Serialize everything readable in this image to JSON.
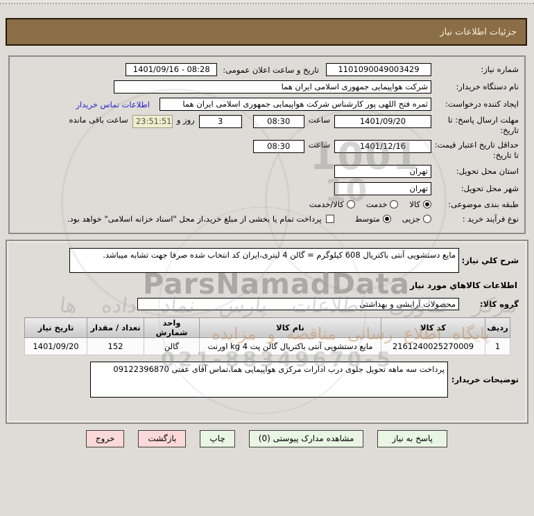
{
  "title_bar": {
    "title": "جزئیات اطلاعات نیاز"
  },
  "section1": {
    "need_number_label": "شماره نیاز:",
    "need_number_value": "1101090049003429",
    "announce_label": "تاریخ و ساعت اعلان عمومی:",
    "announce_value": "1401/09/16 - 08:28",
    "buyer_org_label": "نام دستگاه خریدار:",
    "buyer_org_value": "شرکت هواپیمایی جمهوری اسلامی ایران هما",
    "creator_label": "ایجاد کننده درخواست:",
    "creator_value": "ثمره فتح اللهی پور کارشناس شرکت هواپیمایی جمهوری اسلامی ایران هما",
    "contact_link": "اطلاعات تماس خریدار",
    "deadline_label": "مهلت ارسال پاسخ: تا تاریخ:",
    "deadline_date": "1401/09/20",
    "hour_label": "ساعت",
    "deadline_time": "08:30",
    "days_value": "3",
    "days_label": "روز و",
    "remaining_value": "23:51:51",
    "remaining_label": "ساعت باقی مانده",
    "validity_label": "حداقل تاریخ اعتبار قیمت: تا تاریخ:",
    "validity_date": "1401/12/16",
    "validity_time": "08:30",
    "province_label": "استان محل تحویل:",
    "province_value": "تهران",
    "city_label": "شهر محل تحویل:",
    "city_value": "تهران",
    "classification_label": "طبقه بندی موضوعی:",
    "class_options": [
      {
        "label": "کالا",
        "selected": true
      },
      {
        "label": "خدمت",
        "selected": false
      },
      {
        "label": "کالا/خدمت",
        "selected": false
      }
    ],
    "process_label": "نوع فرآیند خرید :",
    "process_options": [
      {
        "label": "جزیی",
        "selected": false
      },
      {
        "label": "متوسط",
        "selected": true
      }
    ],
    "treasury_checkbox_label": "پرداخت تمام یا بخشی از مبلغ خرید،از محل \"اسناد خزانه اسلامی\" خواهد بود.",
    "treasury_checked": false
  },
  "section2": {
    "desc_label": "شرح کلي نیاز:",
    "desc_value": "مایع دستشویی آنتی باکتریال 608 کیلوگرم = گالن 4 لیتری،ایران کد انتخاب شده صرفا جهت تشابه میباشد.",
    "goods_heading": "اطلاعات کالاهاي مورد نیاز",
    "group_label": "گروه کالا:",
    "group_value": "محصولات آرایشی و بهداشتی",
    "table": {
      "headers": [
        "ردیف",
        "کد کالا",
        "نام کالا",
        "واحد شمارش",
        "تعداد / مقدار",
        "تاریخ نیاز"
      ],
      "rows": [
        {
          "row_no": "1",
          "code": "2161240025270009",
          "name": "مایع دستشویی آنتی باکتریال گالن پت 4 kg اورنت",
          "unit": "گالن",
          "qty": "152",
          "need_date": "1401/09/20"
        }
      ]
    },
    "notes_label": "توضیحات خریدار:",
    "notes_value": "پرداخت سه ماهه تحویل جلوی درب ادارات مرکزی هواپیمایی هما،تماس آقای عفتی 09122396870"
  },
  "buttons": {
    "reply": "پاسخ به نیاز",
    "attachments": "مشاهده مدارک پیوستی (0)",
    "print": "چاپ",
    "back": "بازگشت",
    "exit": "خروج"
  },
  "watermark": {
    "logo": "ParsNamadData",
    "fa_line": "مرکز فناوری اطلاعات پارس نماد داده ها",
    "portal_line": "پایگاه اطلاع رسانی مناقصه و مزایده",
    "phone": "021-88349670-5",
    "digits1": "1001",
    "digits2": "10"
  }
}
